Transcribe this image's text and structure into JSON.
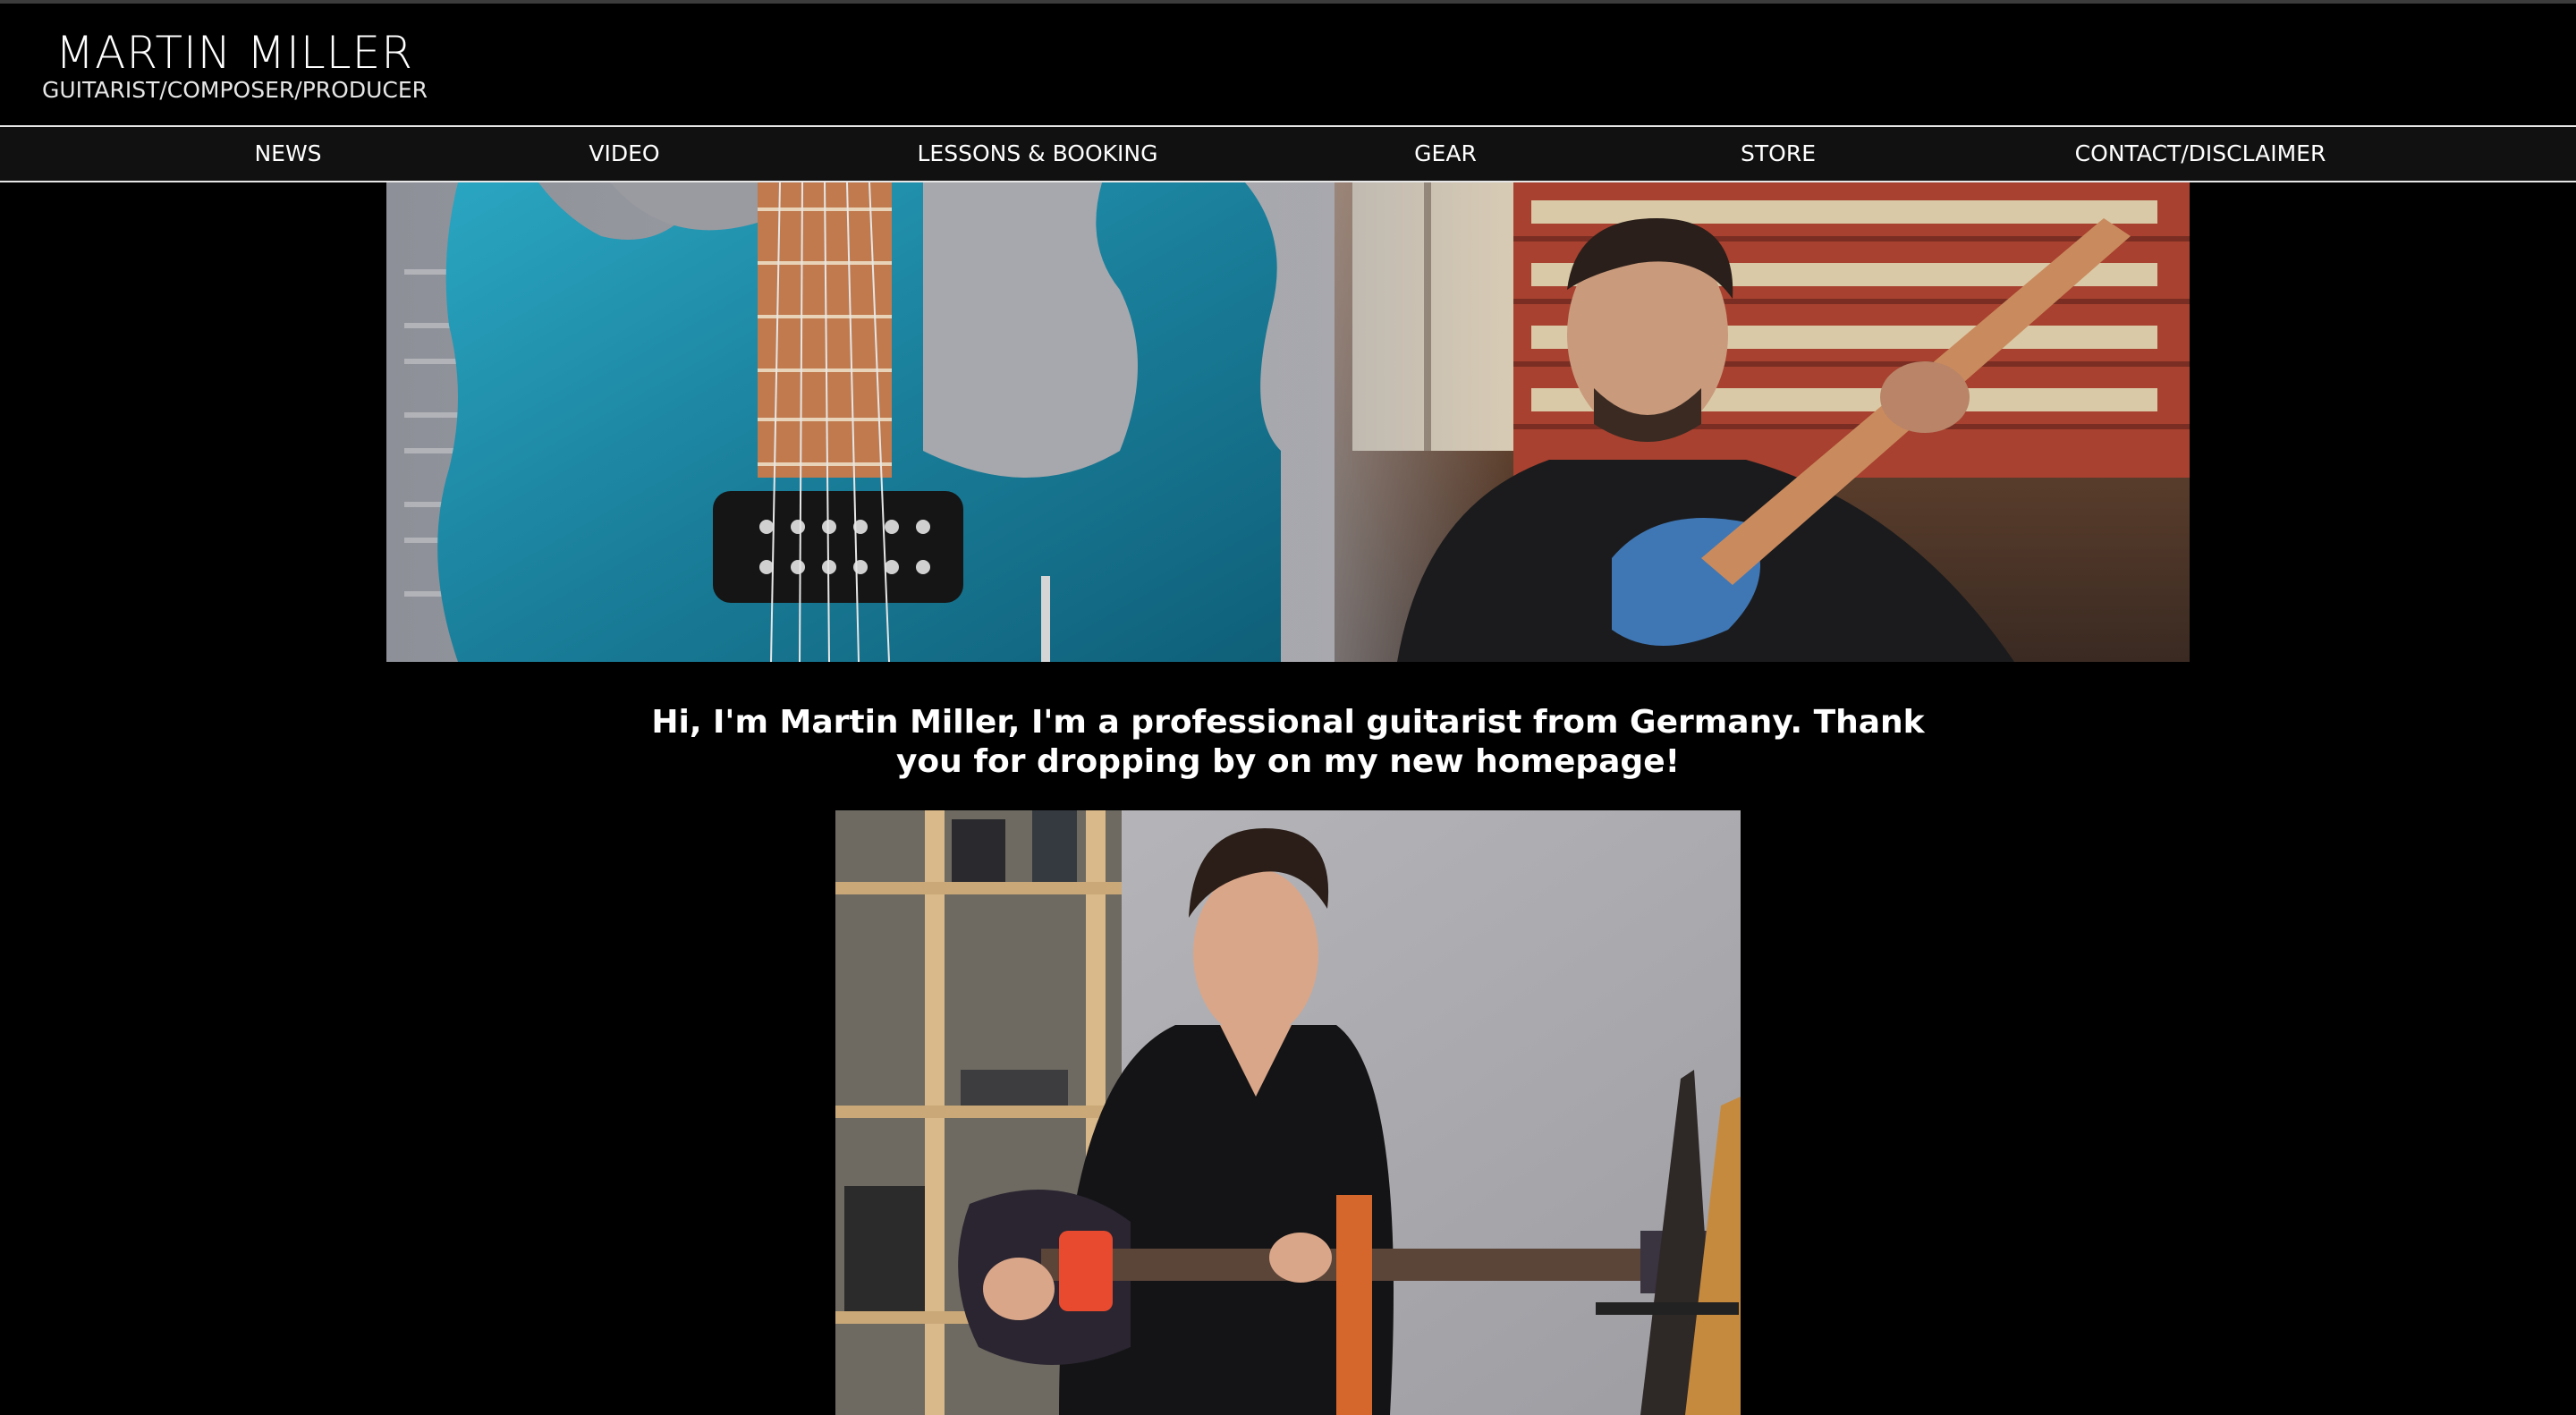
{
  "site": {
    "title": "MARTIN MILLER",
    "subtitle": "GUITARIST/COMPOSER/PRODUCER"
  },
  "nav": {
    "items": [
      {
        "label": "NEWS"
      },
      {
        "label": "VIDEO"
      },
      {
        "label": "LESSONS & BOOKING"
      },
      {
        "label": "GEAR"
      },
      {
        "label": "STORE"
      },
      {
        "label": "CONTACT/DISCLAIMER"
      }
    ]
  },
  "banner": {
    "image_description": "Banner: teal flame-top electric guitar body on the left, guitarist in black leather jacket holding a blue guitar in a room with red bookshelves on the right",
    "icon": "banner-image"
  },
  "intro": {
    "text": "Hi, I'm Martin Miller, I'm a professional guitarist from Germany. Thank you for dropping by on my new homepage!"
  },
  "portrait": {
    "image_description": "Smiling guitarist in black t-shirt playing a dark electric guitar with a red capo, shelves and guitars in background",
    "icon": "portrait-image"
  },
  "colors": {
    "background": "#000000",
    "nav_background": "#111111",
    "nav_border": "#e6e6e6",
    "text": "#ffffff",
    "guitar_teal": "#1f8fab",
    "bookshelf_red": "#a8412f"
  }
}
